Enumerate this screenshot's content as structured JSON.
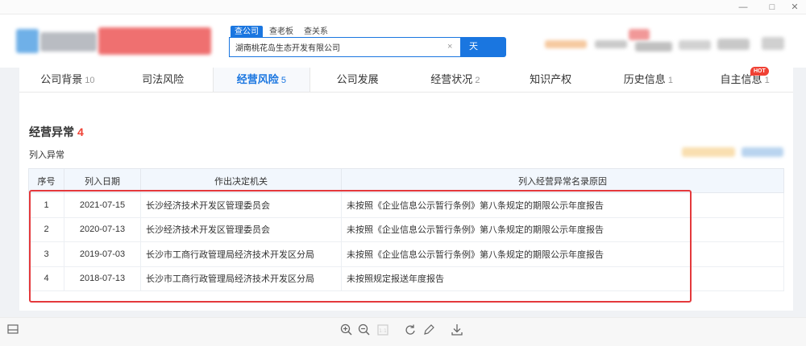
{
  "window": {
    "minimize": "—",
    "maximize": "□",
    "close": "✕"
  },
  "search": {
    "tabs": [
      "查公司",
      "查老板",
      "查关系"
    ],
    "active_tab": 0,
    "value": "湖南桃花岛生态开发有限公司",
    "clear": "×",
    "button_label": "天"
  },
  "tabs": [
    {
      "label": "公司背景",
      "count": "10"
    },
    {
      "label": "司法风险",
      "count": ""
    },
    {
      "label": "经营风险",
      "count": "5"
    },
    {
      "label": "公司发展",
      "count": ""
    },
    {
      "label": "经营状况",
      "count": "2"
    },
    {
      "label": "知识产权",
      "count": ""
    },
    {
      "label": "历史信息",
      "count": "1"
    },
    {
      "label": "自主信息",
      "count": "1"
    }
  ],
  "active_tab_index": 2,
  "hot_badge": "HOT",
  "section": {
    "title": "经营异常",
    "count": "4",
    "subtitle": "列入异常"
  },
  "table": {
    "columns": [
      "序号",
      "列入日期",
      "作出决定机关",
      "列入经营异常名录原因"
    ],
    "rows": [
      [
        "1",
        "2021-07-15",
        "长沙经济技术开发区管理委员会",
        "未按照《企业信息公示暂行条例》第八条规定的期限公示年度报告"
      ],
      [
        "2",
        "2020-07-13",
        "长沙经济技术开发区管理委员会",
        "未按照《企业信息公示暂行条例》第八条规定的期限公示年度报告"
      ],
      [
        "3",
        "2019-07-03",
        "长沙市工商行政管理局经济技术开发区分局",
        "未按照《企业信息公示暂行条例》第八条规定的期限公示年度报告"
      ],
      [
        "4",
        "2018-07-13",
        "长沙市工商行政管理局经济技术开发区分局",
        "未按照规定报送年度报告"
      ]
    ]
  },
  "colors": {
    "accent": "#1a76e0",
    "highlight": "#e4393c",
    "count": "#f04134"
  },
  "toolbar_icons": [
    "sidebar-icon",
    "zoom-in-icon",
    "zoom-out-icon",
    "fit-icon",
    "rotate-icon",
    "edit-icon",
    "download-icon"
  ]
}
